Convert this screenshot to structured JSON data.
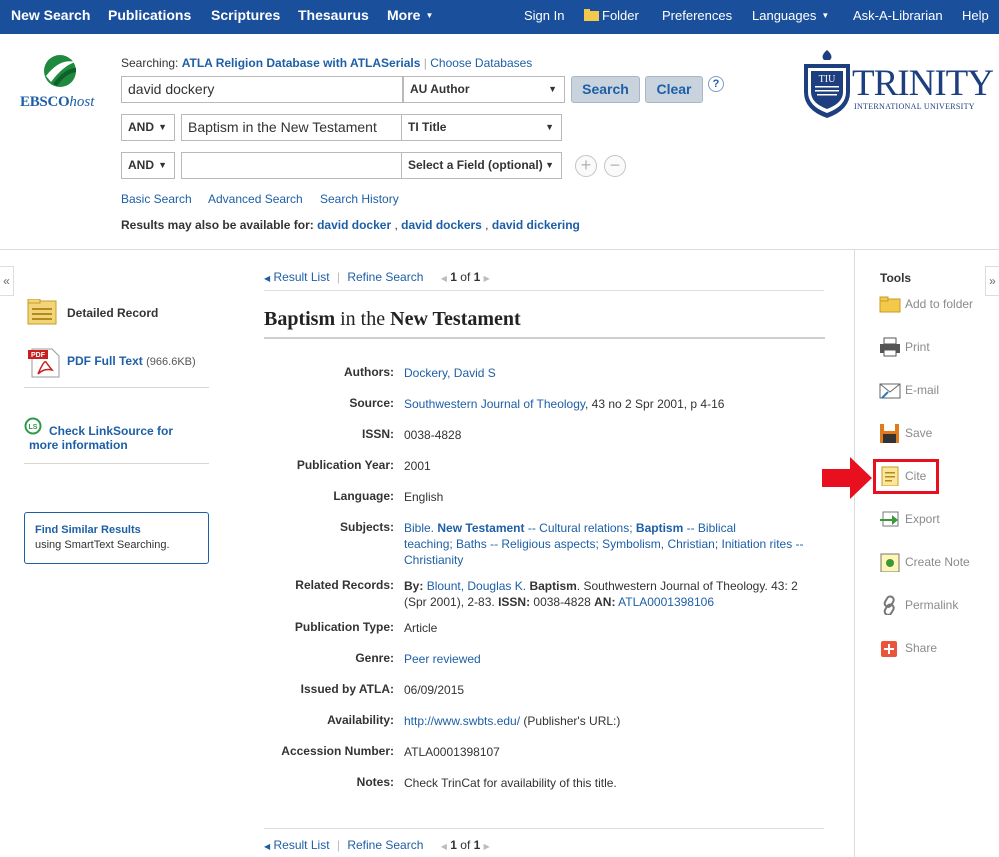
{
  "topnav": {
    "left": [
      "New Search",
      "Publications",
      "Scriptures",
      "Thesaurus",
      "More"
    ],
    "right": [
      "Sign In",
      "Folder",
      "Preferences",
      "Languages",
      "Ask-A-Librarian",
      "Help"
    ]
  },
  "logo": {
    "ebsco": "EBSCO",
    "host": "host",
    "trinity_main": "TRINITY",
    "trinity_sub": "INTERNATIONAL UNIVERSITY",
    "tiu": "TIU"
  },
  "search": {
    "searching_label": "Searching:",
    "database": "ATLA Religion Database with ATLASerials",
    "choose_databases": "Choose Databases",
    "rows": [
      {
        "bool": "",
        "term": "david dockery",
        "field": "AU Author"
      },
      {
        "bool": "AND",
        "term": "Baptism in the New Testament",
        "field": "TI Title"
      },
      {
        "bool": "AND",
        "term": "",
        "field": "Select a Field (optional)"
      }
    ],
    "search_button": "Search",
    "clear_button": "Clear",
    "help": "?",
    "links": [
      "Basic Search",
      "Advanced Search",
      "Search History"
    ],
    "also_available_label": "Results may also be available for:",
    "suggestions": [
      "david docker",
      "david dockers",
      "david dickering"
    ]
  },
  "left": {
    "detailed_record": "Detailed Record",
    "pdf_label": "PDF Full Text",
    "pdf_size": "(966.6KB)",
    "pdf_badge": "PDF",
    "linksource_line1": "Check LinkSource for",
    "linksource_line2": "more information",
    "find_similar_title": "Find Similar Results",
    "find_similar_sub": "using SmartText Searching."
  },
  "pager": {
    "result_list": "Result List",
    "refine_search": "Refine Search",
    "page": "1",
    "of": "of",
    "total": "1"
  },
  "record": {
    "title_parts": [
      "Baptism",
      " in the ",
      "New Testament"
    ],
    "fields": {
      "authors_label": "Authors:",
      "authors_value": "Dockery, David S",
      "source_label": "Source:",
      "source_link": "Southwestern Journal of Theology",
      "source_rest": ", 43 no 2 Spr 2001, p 4-16",
      "issn_label": "ISSN:",
      "issn_value": "0038-4828",
      "pubyear_label": "Publication Year:",
      "pubyear_value": "2001",
      "language_label": "Language:",
      "language_value": "English",
      "subjects_label": "Subjects:",
      "related_label": "Related Records:",
      "pubtype_label": "Publication Type:",
      "pubtype_value": "Article",
      "genre_label": "Genre:",
      "genre_value": "Peer reviewed",
      "issued_label": "Issued by ATLA:",
      "issued_value": "06/09/2015",
      "availability_label": "Availability:",
      "availability_link": "http://www.swbts.edu/",
      "availability_rest": " (Publisher's URL:)",
      "accession_label": "Accession Number:",
      "accession_value": "ATLA0001398107",
      "notes_label": "Notes:",
      "notes_value": "Check TrinCat for availability of this title."
    },
    "subjects": {
      "s1": "Bible.",
      "s2": "New Testament",
      "s3": " -- Cultural relations;",
      "s4": "Baptism",
      "s5": " -- Biblical",
      "s6": "teaching;",
      "s7": "Baths -- Religious aspects;",
      "s8": "Symbolism, Christian;",
      "s9": "Initiation rites --",
      "s10": "Christianity"
    },
    "related": {
      "by": "By:",
      "author": "Blount, Douglas K.",
      "title": "Baptism",
      "journal": ". Southwestern Journal of Theology. 43: 2",
      "line2": "(Spr 2001), 2-83.",
      "issn_label": "ISSN:",
      "issn": " 0038-4828 ",
      "an_label": "AN:",
      "an": "ATLA0001398106"
    }
  },
  "tools": {
    "heading": "Tools",
    "items": [
      "Add to folder",
      "Print",
      "E-mail",
      "Save",
      "Cite",
      "Export",
      "Create Note",
      "Permalink",
      "Share"
    ]
  },
  "colors": {
    "nav": "#1a4f9c",
    "link": "#1d5fa6",
    "highlight": "#e8101e"
  }
}
